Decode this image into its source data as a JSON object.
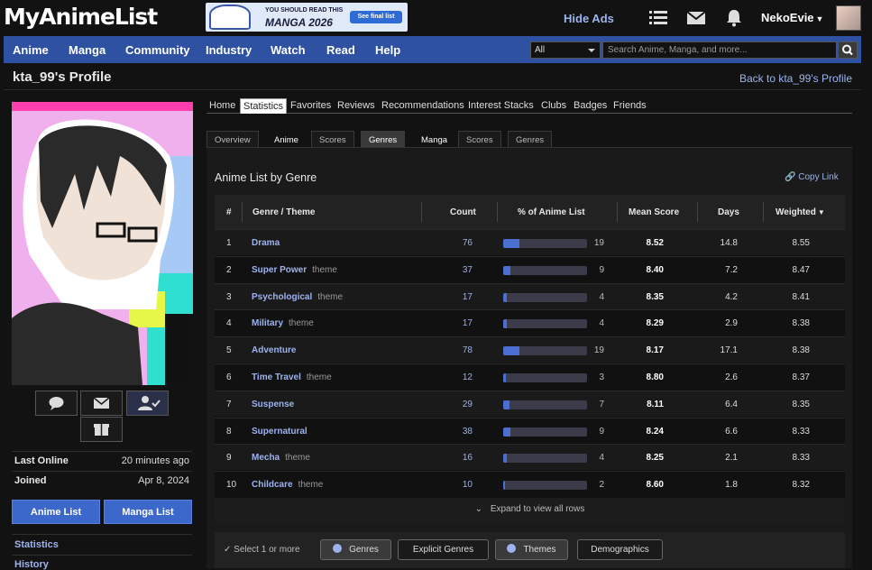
{
  "header": {
    "logo": "MyAnimeList",
    "ad": {
      "line1": "YOU SHOULD READ THIS",
      "line2": "MANGA 2026",
      "button": "See final list"
    },
    "hide_ads": "Hide Ads",
    "username": "NekoEvie"
  },
  "nav": {
    "items": [
      "Anime",
      "Manga",
      "Community",
      "Industry",
      "Watch",
      "Read",
      "Help"
    ],
    "search_category": "All",
    "search_placeholder": "Search Anime, Manga, and more..."
  },
  "profile": {
    "title": "kta_99's Profile",
    "back_link": "Back to kta_99's Profile",
    "last_online_label": "Last Online",
    "last_online": "20 minutes ago",
    "joined_label": "Joined",
    "joined": "Apr 8, 2024",
    "anime_list_button": "Anime List",
    "manga_list_button": "Manga List",
    "links": [
      "Statistics",
      "History"
    ]
  },
  "tabs": [
    "Home",
    "Statistics",
    "Favorites",
    "Reviews",
    "Recommendations",
    "Interest Stacks",
    "Clubs",
    "Badges",
    "Friends"
  ],
  "active_tab": "Statistics",
  "subtabs": [
    "Overview",
    "Anime",
    "Scores",
    "Genres",
    "Manga",
    "Scores",
    "Genres"
  ],
  "active_subtab": "Genres",
  "list": {
    "title": "Anime List by Genre",
    "copy_link": "Copy Link",
    "columns": [
      "#",
      "Genre / Theme",
      "Count",
      "% of Anime List",
      "Mean Score",
      "Days",
      "Weighted"
    ],
    "rows": [
      {
        "rank": "1",
        "name": "Drama",
        "tag": "",
        "count": "76",
        "pct": "19",
        "mean": "8.52",
        "days": "14.8",
        "weighted": "8.55"
      },
      {
        "rank": "2",
        "name": "Super Power",
        "tag": "theme",
        "count": "37",
        "pct": "9",
        "mean": "8.40",
        "days": "7.2",
        "weighted": "8.47"
      },
      {
        "rank": "3",
        "name": "Psychological",
        "tag": "theme",
        "count": "17",
        "pct": "4",
        "mean": "8.35",
        "days": "4.2",
        "weighted": "8.41"
      },
      {
        "rank": "4",
        "name": "Military",
        "tag": "theme",
        "count": "17",
        "pct": "4",
        "mean": "8.29",
        "days": "2.9",
        "weighted": "8.38"
      },
      {
        "rank": "5",
        "name": "Adventure",
        "tag": "",
        "count": "78",
        "pct": "19",
        "mean": "8.17",
        "days": "17.1",
        "weighted": "8.38"
      },
      {
        "rank": "6",
        "name": "Time Travel",
        "tag": "theme",
        "count": "12",
        "pct": "3",
        "mean": "8.80",
        "days": "2.6",
        "weighted": "8.37"
      },
      {
        "rank": "7",
        "name": "Suspense",
        "tag": "",
        "count": "29",
        "pct": "7",
        "mean": "8.11",
        "days": "6.4",
        "weighted": "8.35"
      },
      {
        "rank": "8",
        "name": "Supernatural",
        "tag": "",
        "count": "38",
        "pct": "9",
        "mean": "8.24",
        "days": "6.6",
        "weighted": "8.33"
      },
      {
        "rank": "9",
        "name": "Mecha",
        "tag": "theme",
        "count": "16",
        "pct": "4",
        "mean": "8.25",
        "days": "2.1",
        "weighted": "8.33"
      },
      {
        "rank": "10",
        "name": "Childcare",
        "tag": "theme",
        "count": "10",
        "pct": "2",
        "mean": "8.60",
        "days": "1.8",
        "weighted": "8.32"
      }
    ],
    "expand": "Expand to view all rows"
  },
  "filters": {
    "label": "Select 1 or more",
    "chips": [
      {
        "label": "Genres",
        "selected": true
      },
      {
        "label": "Explicit Genres",
        "selected": false
      },
      {
        "label": "Themes",
        "selected": true
      },
      {
        "label": "Demographics",
        "selected": false
      }
    ]
  },
  "colors": {
    "brand": "#2e51a2",
    "link": "#9db3ee",
    "bar": "#4a6fd1",
    "button": "#3c68cc"
  }
}
